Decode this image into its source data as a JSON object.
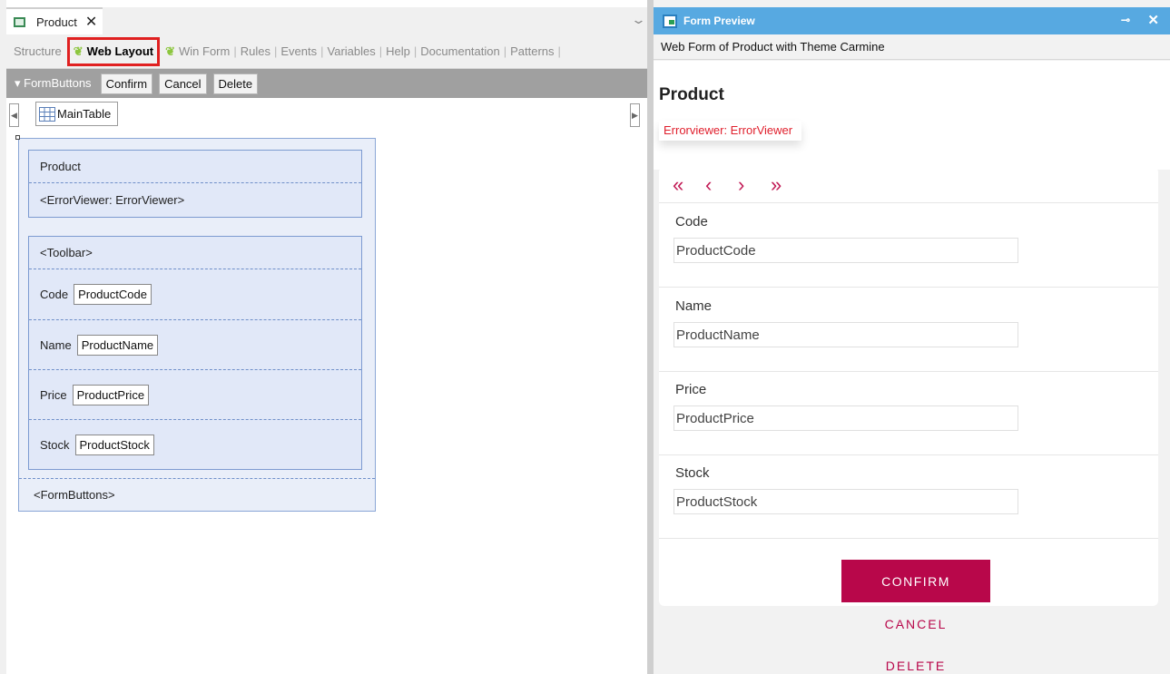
{
  "editor": {
    "doc_tab": {
      "title": "Product",
      "close": "✕"
    },
    "view_tabs": {
      "structure": "Structure",
      "web_layout": "Web Layout",
      "win_form": "Win Form",
      "rules": "Rules",
      "events": "Events",
      "variables": "Variables",
      "help": "Help",
      "documentation": "Documentation",
      "patterns": "Patterns"
    },
    "formbar": {
      "label": "FormButtons",
      "confirm": "Confirm",
      "cancel": "Cancel",
      "delete": "Delete"
    },
    "maintable": "MainTable",
    "canvas": {
      "header_title": "Product",
      "error_viewer": "<ErrorViewer: ErrorViewer>",
      "toolbar": "<Toolbar>",
      "fields": [
        {
          "label": "Code",
          "value": "ProductCode"
        },
        {
          "label": "Name",
          "value": "ProductName"
        },
        {
          "label": "Price",
          "value": "ProductPrice"
        },
        {
          "label": "Stock",
          "value": "ProductStock"
        }
      ],
      "form_buttons": "<FormButtons>"
    }
  },
  "preview": {
    "title": "Form Preview",
    "subtitle": "Web Form of Product with Theme Carmine",
    "heading": "Product",
    "error": "Errorviewer: ErrorViewer",
    "nav": {
      "first": "«",
      "prev": "‹",
      "next": "›",
      "last": "»"
    },
    "fields": [
      {
        "label": "Code",
        "value": "ProductCode"
      },
      {
        "label": "Name",
        "value": "ProductName"
      },
      {
        "label": "Price",
        "value": "ProductPrice"
      },
      {
        "label": "Stock",
        "value": "ProductStock"
      }
    ],
    "confirm": "CONFIRM",
    "cancel": "CANCEL",
    "delete": "DELETE"
  },
  "colors": {
    "accent": "#b8074a",
    "preview_title_bar": "#57a9e1",
    "highlight": "#e02020"
  }
}
